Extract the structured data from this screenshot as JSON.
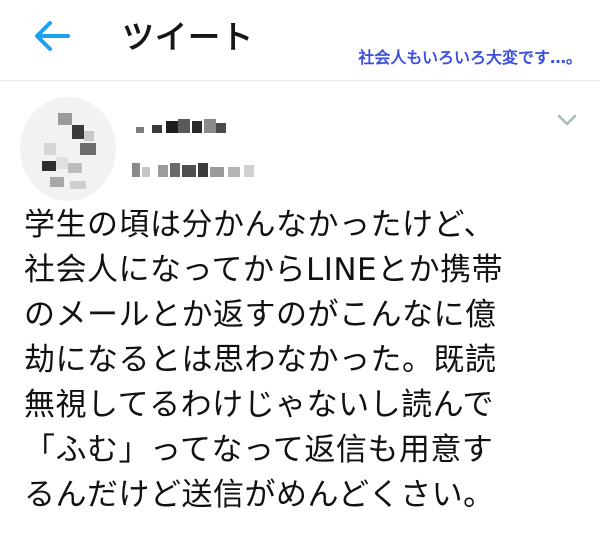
{
  "header": {
    "back_icon": "arrow-left-icon",
    "title": "ツイート",
    "caption": "社会人もいろいろ大変です…。"
  },
  "tweet": {
    "menu_icon": "chevron-down-icon",
    "lines": [
      "学生の頃は分かんなかったけど、",
      "社会人になってからLINEとか携帯",
      "のメールとか返すのがこんなに億",
      "劫になるとは思わなかった。既読",
      "無視してるわけじゃないし読んで",
      "「ふむ」ってなって返信も用意す",
      "るんだけど送信がめんどくさい。"
    ]
  },
  "colors": {
    "accent": "#1da1f2",
    "caption": "#3b4fe0",
    "text": "#111111"
  }
}
